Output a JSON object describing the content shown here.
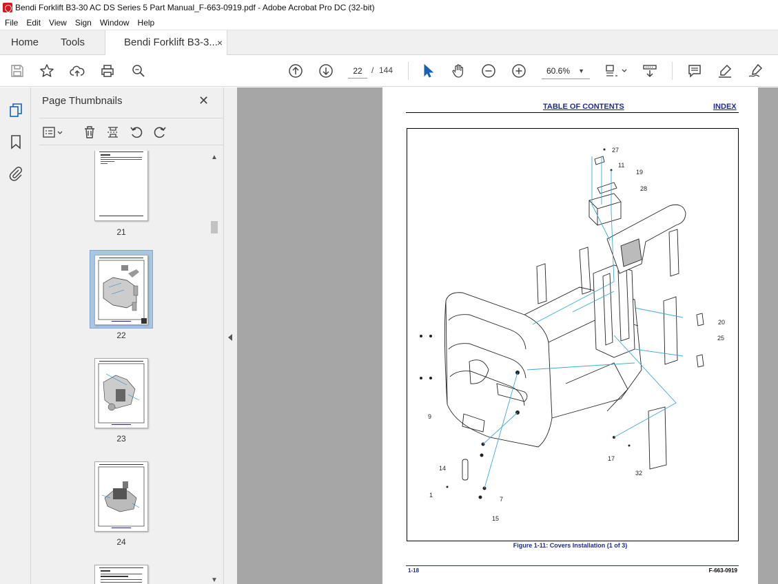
{
  "window": {
    "title": "Bendi Forklift B3-30 AC DS Series 5 Part Manual_F-663-0919.pdf - Adobe Acrobat Pro DC (32-bit)"
  },
  "menu": [
    "File",
    "Edit",
    "View",
    "Sign",
    "Window",
    "Help"
  ],
  "tabs": {
    "home": "Home",
    "tools": "Tools",
    "document": "Bendi Forklift B3-3...",
    "close": "×"
  },
  "toolbar": {
    "current_page": "22",
    "page_separator": "/",
    "total_pages": "144",
    "zoom": "60.6%",
    "zoom_caret": "▼"
  },
  "thumbnails_panel": {
    "title": "Page Thumbnails",
    "close": "✕",
    "pages": [
      {
        "label": "21"
      },
      {
        "label": "22",
        "selected": true
      },
      {
        "label": "23"
      },
      {
        "label": "24"
      }
    ]
  },
  "document_page": {
    "link_toc": "TABLE OF CONTENTS",
    "link_index": "INDEX",
    "figure_caption": "Figure 1-11:  Covers Installation (1 of 3)",
    "footer_left": "1-18",
    "footer_right": "F-663-0919",
    "callouts": [
      "27",
      "11",
      "19",
      "28",
      "20",
      "25",
      "9",
      "17",
      "32",
      "14",
      "1",
      "7",
      "15"
    ]
  },
  "colors": {
    "link_blue": "#1f2b8a",
    "leader_line": "#3fa7d6",
    "doc_background": "#a6a6a6",
    "selection": "#a9c7e3"
  }
}
